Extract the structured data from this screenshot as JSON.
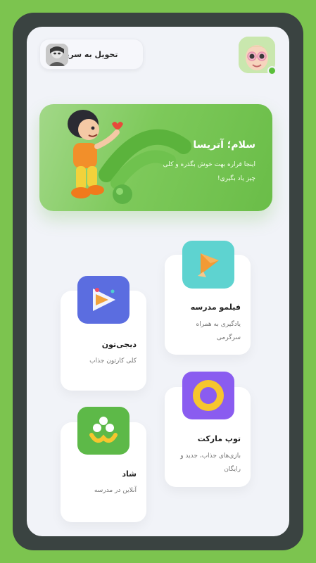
{
  "header": {
    "deliver_label": "تحویل به سرپرست"
  },
  "hero": {
    "title": "سلام؛ آتریسا",
    "text": "اینجا قراره بهت خوش بگذره و کلی چیز یاد بگیری!"
  },
  "apps": [
    {
      "name": "فیلمو مدرسه",
      "desc": "یادگیری به همراه سرگرمی",
      "icon": "filimo-pencil-play-icon",
      "color": "#5ed3d0"
    },
    {
      "name": "دیجی‌تون",
      "desc": "کلی کارتون جذاب",
      "icon": "digitoon-play-icon",
      "color": "#5b6de0"
    },
    {
      "name": "توپ مارکت",
      "desc": "بازی‌های جذاب، جدید و رایگان",
      "icon": "ring-icon",
      "color": "#8a5cf0"
    },
    {
      "name": "شاد",
      "desc": "آنلاین در مدرسه",
      "icon": "shad-logo-icon",
      "color": "#5db948"
    }
  ],
  "colors": {
    "frame": "#7cc44f",
    "bezel": "#3a4341",
    "screen": "#f1f3f8",
    "online": "#5abf3a"
  }
}
